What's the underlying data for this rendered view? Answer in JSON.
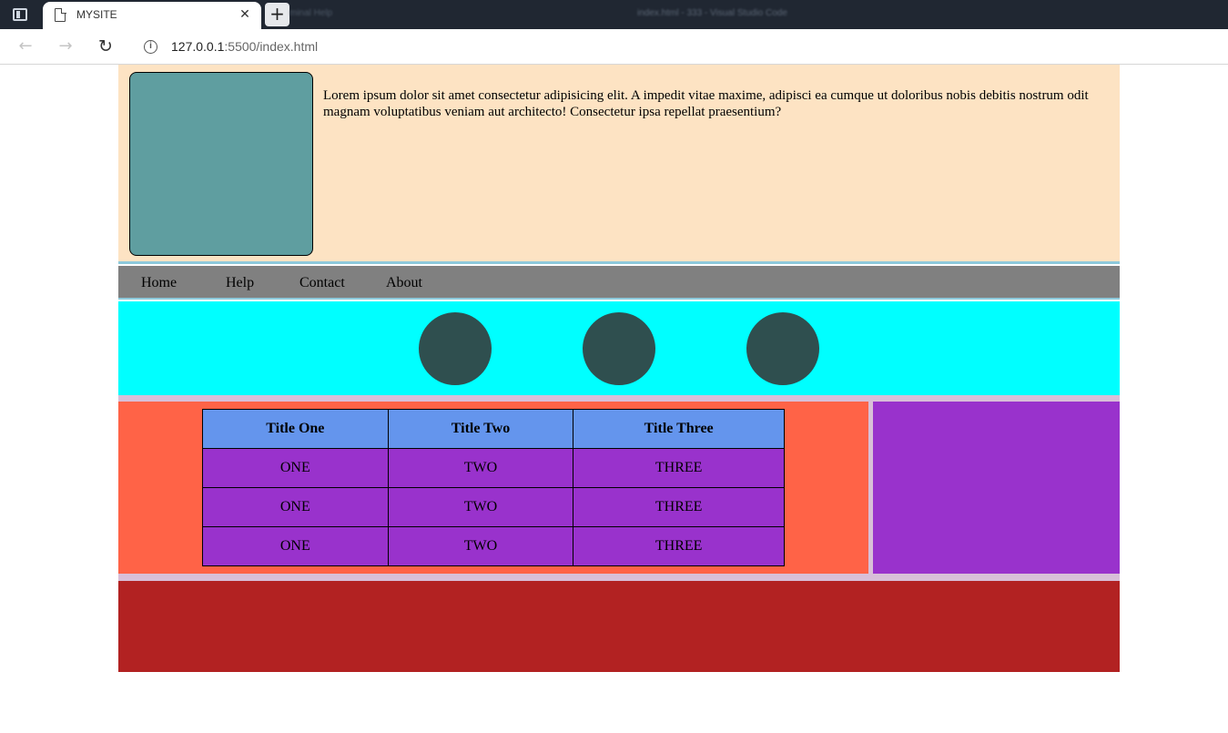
{
  "browser": {
    "tab_title": "MYSITE",
    "tab_close_glyph": "✕",
    "new_tab_glyph": "+",
    "background_menu": "minal   Help",
    "background_window_title": "index.html - 333 - Visual Studio Code",
    "url_host": "127.0.0.1",
    "url_path": ":5500/index.html",
    "back_glyph": "←",
    "forward_glyph": "→",
    "reload_glyph": "↻",
    "info_glyph": "i"
  },
  "header": {
    "intro_text": "Lorem ipsum dolor sit amet consectetur adipisicing elit. A impedit vitae maxime, adipisci ea cumque ut doloribus nobis debitis nostrum odit magnam voluptatibus veniam aut architecto! Consectetur ipsa repellat praesentium?"
  },
  "nav": {
    "items": [
      "Home",
      "Help",
      "Contact",
      "About"
    ]
  },
  "table": {
    "headers": [
      "Title One",
      "Title Two",
      "Title Three"
    ],
    "rows": [
      [
        "ONE",
        "TWO",
        "THREE"
      ],
      [
        "ONE",
        "TWO",
        "THREE"
      ],
      [
        "ONE",
        "TWO",
        "THREE"
      ]
    ]
  },
  "colors": {
    "header_bg": "#fde3c3",
    "avatar_box": "#5f9ea0",
    "navbar_bg": "#808080",
    "circles_bg": "#00ffff",
    "circle": "#2f4f4f",
    "separator": "#d8bfd8",
    "main_left_bg": "#ff6347",
    "main_right_bg": "#9932cc",
    "table_header_bg": "#6495ed",
    "table_cell_bg": "#9932cc",
    "footer_bg": "#b22222"
  }
}
